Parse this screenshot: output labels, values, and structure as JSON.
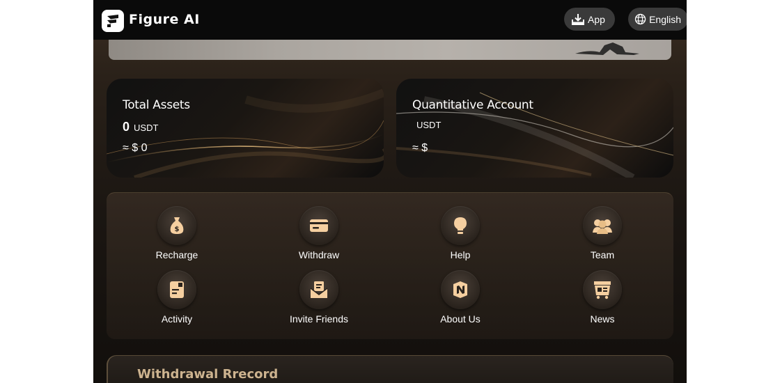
{
  "header": {
    "brand": "Figure AI",
    "app_button": "App",
    "language_button": "English"
  },
  "assets": {
    "total": {
      "title": "Total Assets",
      "amount": "0",
      "unit": "USDT",
      "approx": "≈ $ 0"
    },
    "quant": {
      "title": "Quantitative Account",
      "amount": "",
      "unit": "USDT",
      "approx": "≈ $"
    }
  },
  "menu": {
    "items": [
      {
        "label": "Recharge",
        "icon": "money-bag-icon"
      },
      {
        "label": "Withdraw",
        "icon": "card-icon"
      },
      {
        "label": "Help",
        "icon": "lightbulb-icon"
      },
      {
        "label": "Team",
        "icon": "team-icon"
      },
      {
        "label": "Activity",
        "icon": "document-icon"
      },
      {
        "label": "Invite Friends",
        "icon": "envelope-icon"
      },
      {
        "label": "About Us",
        "icon": "logo-n-icon"
      },
      {
        "label": "News",
        "icon": "news-cart-icon"
      }
    ]
  },
  "record": {
    "title": "Withdrawal Rrecord"
  },
  "colors": {
    "icon_fill": "#f5cfa0",
    "record_title": "#cdb38f",
    "header_bg": "#0a0a0a"
  }
}
